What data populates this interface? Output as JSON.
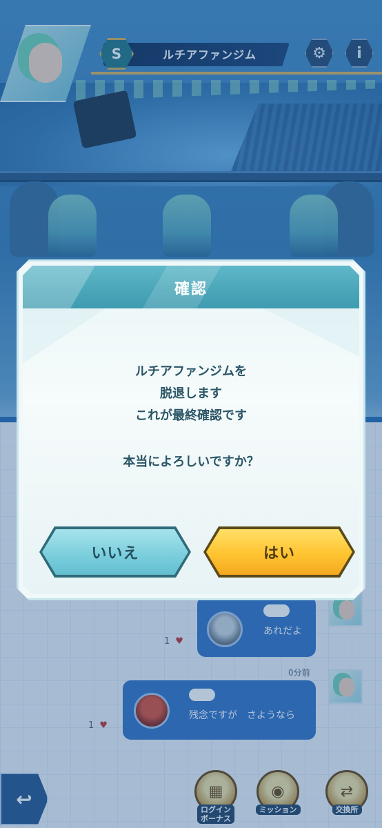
{
  "header": {
    "gym_name": "ルチアファンジム",
    "rank": "S",
    "settings_icon": "gear-icon",
    "info_label": "i"
  },
  "chat": {
    "messages": [
      {
        "text": "あれだよ",
        "likes": "1"
      },
      {
        "timestamp": "0分前",
        "text": "残念ですが　さようなら",
        "likes": "1"
      }
    ]
  },
  "bottom_nav": {
    "back_icon": "back-arrow-icon",
    "items": [
      {
        "label": "ログイン\nボーナス"
      },
      {
        "label": "ミッション"
      },
      {
        "label": "交換所"
      }
    ]
  },
  "dialog": {
    "title": "確認",
    "message_lines": [
      "ルチアファンジムを",
      "脱退します",
      "これが最終確認です"
    ],
    "question": "本当によろしいですか？",
    "no_label": "いいえ",
    "yes_label": "はい"
  },
  "colors": {
    "dialog_header": "#4aa5b8",
    "no_button": "#7dcfdd",
    "yes_button": "#ffc431",
    "chat_bubble": "#3877c6"
  }
}
